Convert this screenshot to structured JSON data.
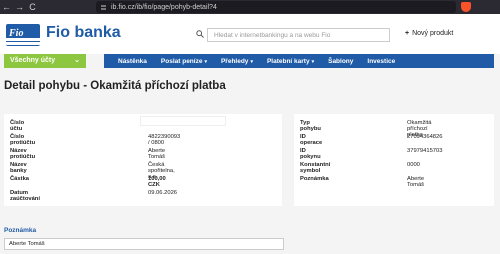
{
  "browser": {
    "url": "ib.fio.cz/ib/fio/page/pohyb-detail?4",
    "back": "←",
    "forward": "→",
    "reload": "C"
  },
  "header": {
    "logo_tag": "Fio",
    "logo_text": "Fio banka",
    "search_placeholder": "Hledat v internetbankingu a na webu Fio",
    "new_product_plus": "+",
    "new_product_label": "Nový produkt"
  },
  "accounts_button": {
    "label": "Všechny účty",
    "chevron": "⌄"
  },
  "nav": {
    "items": [
      {
        "label": "Nástěnka",
        "caret": ""
      },
      {
        "label": "Poslat peníze",
        "caret": "▾"
      },
      {
        "label": "Přehledy",
        "caret": "▾"
      },
      {
        "label": "Platební karty",
        "caret": "▾"
      },
      {
        "label": "Šablony",
        "caret": ""
      },
      {
        "label": "Investice",
        "caret": ""
      }
    ]
  },
  "page_title": "Detail pohybu - Okamžitá příchozí platba",
  "left_card": {
    "rows": [
      {
        "label": "Číslo účtu",
        "value": ""
      },
      {
        "label": "Číslo protiúčtu",
        "value": "4822390093 / 0800"
      },
      {
        "label": "Název protiúčtu",
        "value": "Aberte Tomáš"
      },
      {
        "label": "Název banky",
        "value": "Česká spořitelna, a.s."
      },
      {
        "label": "Částka",
        "value": "100,00 CZK"
      },
      {
        "label": "Datum zaúčtování",
        "value": "09.06.2026"
      }
    ]
  },
  "right_card": {
    "rows": [
      {
        "label": "Typ pohybu",
        "value": "Okamžitá příchozí platba"
      },
      {
        "label": "ID operace",
        "value": "27094364826"
      },
      {
        "label": "ID pokynu",
        "value": "37979415703"
      },
      {
        "label": "Konstantní symbol",
        "value": "0000"
      },
      {
        "label": "Poznámka",
        "value": "Aberte Tomáš"
      }
    ]
  },
  "note": {
    "heading": "Poznámka",
    "value": "Aberte Tomáš"
  },
  "colors": {
    "brand_blue": "#1f5ba6",
    "accent_green": "#8dc63f"
  }
}
